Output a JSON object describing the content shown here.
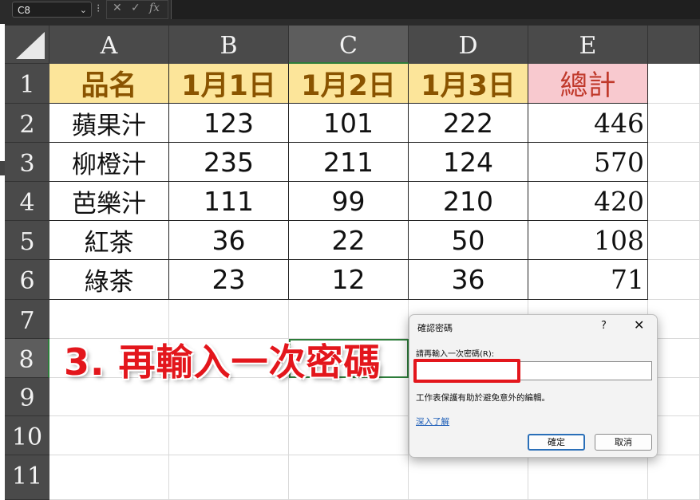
{
  "toolbar": {
    "namebox": "C8",
    "namebox_chevron": "⌄",
    "separator": "⁝",
    "cancel_glyph": "✕",
    "enter_glyph": "✓",
    "fx_label": "fx"
  },
  "columns": [
    "A",
    "B",
    "C",
    "D",
    "E"
  ],
  "rows": [
    "1",
    "2",
    "3",
    "4",
    "5",
    "6",
    "7",
    "8",
    "9",
    "10",
    "11"
  ],
  "table": {
    "header": [
      "品名",
      "1月1日",
      "1月2日",
      "1月3日",
      "總計"
    ],
    "body": [
      [
        "蘋果汁",
        "123",
        "101",
        "222",
        "446"
      ],
      [
        "柳橙汁",
        "235",
        "211",
        "124",
        "570"
      ],
      [
        "芭樂汁",
        "111",
        "99",
        "210",
        "420"
      ],
      [
        "紅茶",
        "36",
        "22",
        "50",
        "108"
      ],
      [
        "綠茶",
        "23",
        "12",
        "36",
        "71"
      ]
    ]
  },
  "annotation": "3. 再輸入一次密碼",
  "dialog": {
    "title": "確認密碼",
    "help": "?",
    "close": "✕",
    "label": "請再輸入一次密碼(R):",
    "password_value": "",
    "description": "工作表保護有助於避免意外的編輯。",
    "link": "深入了解",
    "ok": "確定",
    "cancel": "取消"
  },
  "colors": {
    "header_fill": "#fce59a",
    "header_text": "#8a5400",
    "total_fill": "#f8c9cf",
    "total_text": "#c0392b",
    "annotation": "#e3161c",
    "selection": "#2d7d3a"
  }
}
